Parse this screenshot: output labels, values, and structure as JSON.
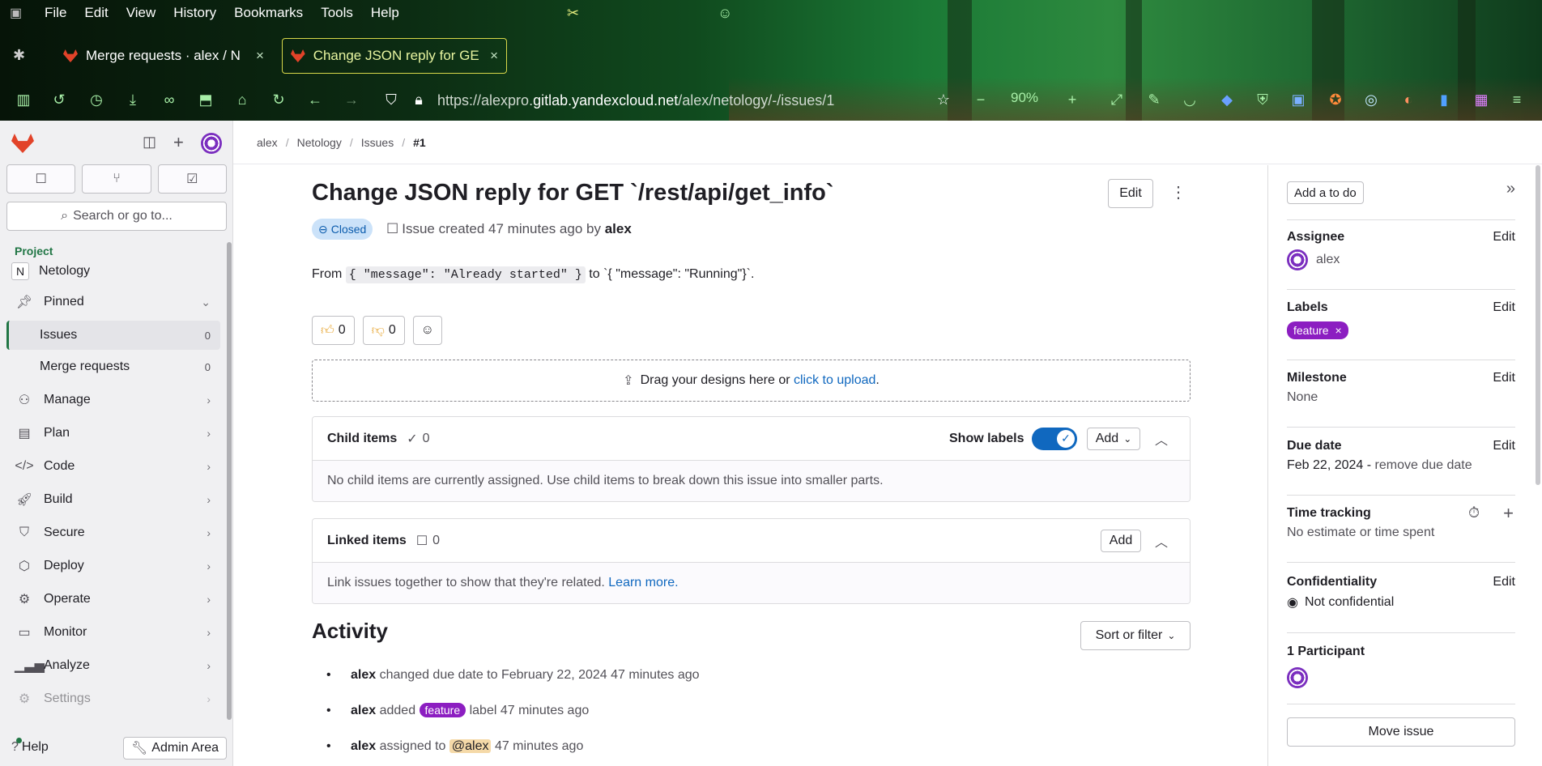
{
  "browser": {
    "menu": [
      "File",
      "Edit",
      "View",
      "History",
      "Bookmarks",
      "Tools",
      "Help"
    ],
    "tabs": [
      {
        "label": "Merge requests · alex / N"
      },
      {
        "label": "Change JSON reply for GE"
      }
    ],
    "url_prefix": "https://alexpro.",
    "url_host": "gitlab.yandexcloud.net",
    "url_path": "/alex/netology/-/issues/1",
    "zoom": "90%"
  },
  "sidebar": {
    "section": "Project",
    "search_label": "Search or go to...",
    "project": {
      "initial": "N",
      "name": "Netology"
    },
    "pinned_label": "Pinned",
    "pinned_items": [
      {
        "label": "Issues",
        "count": "0"
      },
      {
        "label": "Merge requests",
        "count": "0"
      }
    ],
    "menu": [
      {
        "label": "Manage"
      },
      {
        "label": "Plan"
      },
      {
        "label": "Code"
      },
      {
        "label": "Build"
      },
      {
        "label": "Secure"
      },
      {
        "label": "Deploy"
      },
      {
        "label": "Operate"
      },
      {
        "label": "Monitor"
      },
      {
        "label": "Analyze"
      },
      {
        "label": "Settings"
      }
    ],
    "help_label": "Help",
    "admin_label": "Admin Area"
  },
  "breadcrumb": [
    "alex",
    "Netology",
    "Issues",
    "#1"
  ],
  "issue": {
    "title": "Change JSON reply for GET `/rest/api/get_info`",
    "edit_label": "Edit",
    "status": "Closed",
    "meta_prefix": "Issue created 47 minutes ago by",
    "author": "alex",
    "desc_from": "From",
    "desc_code": "{ \"message\": \"Already started\" }",
    "desc_rest": "to `{ \"message\": \"Running\"}`.",
    "thumbs_up": "0",
    "thumbs_down": "0",
    "drop_text": "Drag your designs here or",
    "drop_link": "click to upload",
    "child": {
      "title": "Child items",
      "count": "0",
      "show_labels": "Show labels",
      "add_label": "Add",
      "empty": "No child items are currently assigned. Use child items to break down this issue into smaller parts."
    },
    "linked": {
      "title": "Linked items",
      "count": "0",
      "add_label": "Add",
      "text": "Link issues together to show that they're related.",
      "link": "Learn more."
    },
    "activity_title": "Activity",
    "sort_label": "Sort or filter",
    "activity": [
      {
        "user": "alex",
        "text": "changed due date to February 22, 2024 47 minutes ago"
      },
      {
        "user": "alex",
        "pre": "added",
        "label": "feature",
        "post": "label 47 minutes ago"
      },
      {
        "user": "alex",
        "pre": "assigned to",
        "mention": "@alex",
        "post": "47 minutes ago"
      }
    ]
  },
  "right_sidebar": {
    "todo_label": "Add a to do",
    "edit_label": "Edit",
    "assignee": {
      "heading": "Assignee",
      "value": "alex"
    },
    "labels": {
      "heading": "Labels",
      "value": "feature"
    },
    "milestone": {
      "heading": "Milestone",
      "value": "None"
    },
    "due_date": {
      "heading": "Due date",
      "value": "Feb 22, 2024 -",
      "remove": "remove due date"
    },
    "time_tracking": {
      "heading": "Time tracking",
      "value": "No estimate or time spent"
    },
    "confidentiality": {
      "heading": "Confidentiality",
      "value": "Not confidential"
    },
    "participants": {
      "heading": "1 Participant"
    },
    "move_label": "Move issue"
  },
  "colors": {
    "accent": "#1068bf",
    "label_feature": "#8c1ec1",
    "sidebar_active": "#217645",
    "closed_badge": "#cbe2f9"
  }
}
